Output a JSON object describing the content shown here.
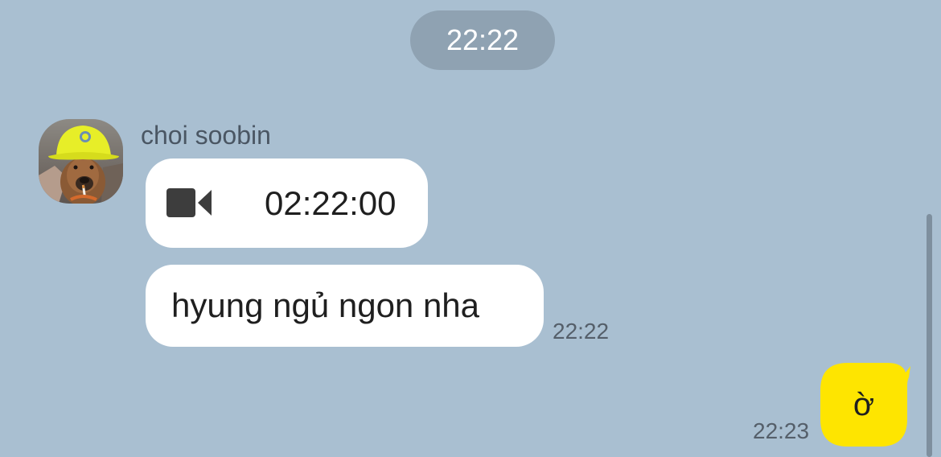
{
  "chat": {
    "date_separator": "22:22",
    "sender": {
      "name": "choi soobin"
    },
    "messages": [
      {
        "type": "video-call",
        "icon": "video-camera-icon",
        "duration": "02:22:00"
      },
      {
        "type": "text",
        "text": "hyung ngủ ngon nha",
        "time": "22:22"
      }
    ],
    "my_message": {
      "text": "ờ",
      "time": "22:23"
    }
  },
  "colors": {
    "background": "#a9bfd1",
    "date_pill": "#8fa2b2",
    "incoming_bubble": "#ffffff",
    "outgoing_bubble": "#fee500",
    "time_text": "#555f6a"
  }
}
